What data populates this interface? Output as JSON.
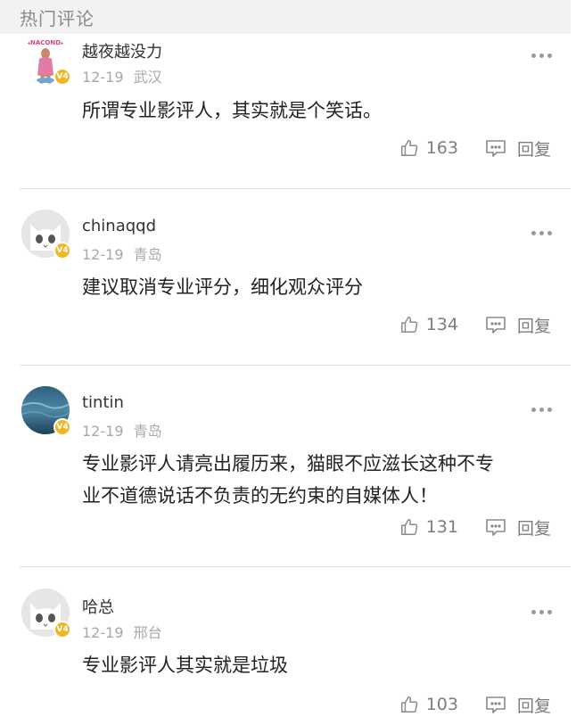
{
  "header": {
    "title": "热门评论"
  },
  "comments": [
    {
      "username": "越夜越没力",
      "date": "12-19",
      "location": "武汉",
      "vip": "V4",
      "avatar_text": "ANACONDA",
      "content_lines": [
        "所谓专业影评人，其实就是个笑话。"
      ],
      "likes": "163",
      "reply_label": "回复"
    },
    {
      "username": "chinaqqd",
      "date": "12-19",
      "location": "青岛",
      "vip": "V4",
      "content_lines": [
        "建议取消专业评分，细化观众评分"
      ],
      "likes": "134",
      "reply_label": "回复"
    },
    {
      "username": "tintin",
      "date": "12-19",
      "location": "青岛",
      "vip": "V4",
      "content_lines": [
        "专业影评人请亮出履历来，猫眼不应滋长这种不专",
        "业不道德说话不负责的无约束的自媒体人！"
      ],
      "likes": "131",
      "reply_label": "回复"
    },
    {
      "username": "哈总",
      "date": "12-19",
      "location": "邢台",
      "vip": "V4",
      "content_lines": [
        "专业影评人其实就是垃圾"
      ],
      "likes": "103",
      "reply_label": "回复"
    }
  ],
  "colors": {
    "vip_badge": "#f0b623",
    "header_bg": "#f2f2f2",
    "meta_text": "#a8a8a8"
  }
}
